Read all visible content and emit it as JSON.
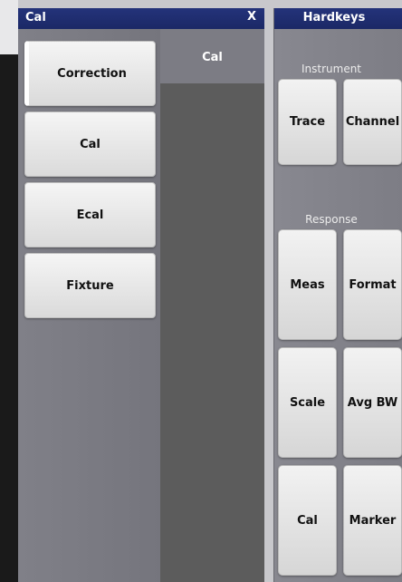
{
  "cal_panel": {
    "title": "Cal",
    "close_label": "X",
    "menu_items": [
      {
        "label": "Correction",
        "selected": true
      },
      {
        "label": "Cal"
      },
      {
        "label": "Ecal"
      },
      {
        "label": "Fixture"
      }
    ],
    "submenu_header": "Cal"
  },
  "hardkeys": {
    "title": "Hardkeys",
    "sections": {
      "instrument": "Instrument",
      "response": "Response"
    },
    "buttons": {
      "trace": "Trace",
      "channel": "Channel",
      "meas": "Meas",
      "format": "Format",
      "scale": "Scale",
      "avg_bw": "Avg BW",
      "cal": "Cal",
      "marker": "Marker"
    }
  }
}
